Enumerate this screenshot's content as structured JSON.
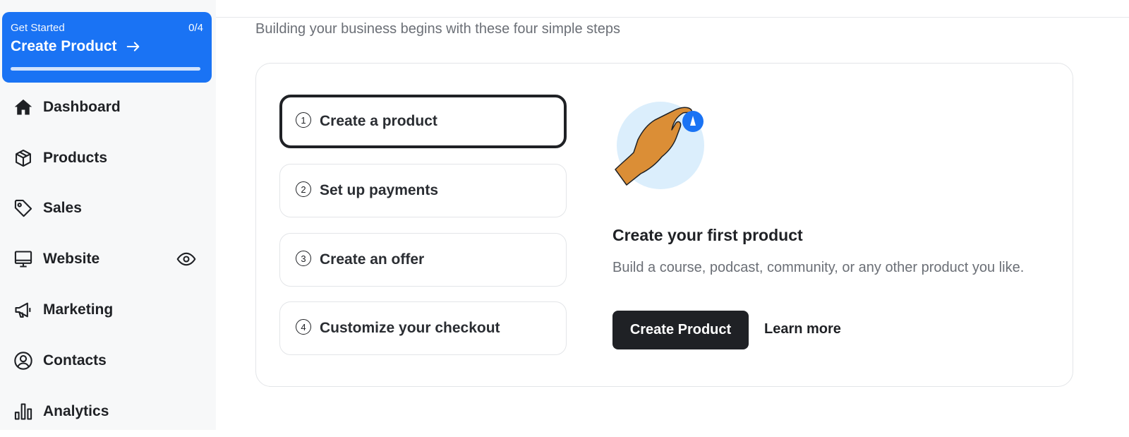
{
  "get_started": {
    "label": "Get Started",
    "count": "0/4",
    "title": "Create Product",
    "progress": 0
  },
  "sidebar": {
    "items": [
      {
        "label": "Dashboard",
        "icon": "home-icon"
      },
      {
        "label": "Products",
        "icon": "box-icon"
      },
      {
        "label": "Sales",
        "icon": "tag-icon"
      },
      {
        "label": "Website",
        "icon": "monitor-icon",
        "extra_icon": "eye-icon"
      },
      {
        "label": "Marketing",
        "icon": "megaphone-icon"
      },
      {
        "label": "Contacts",
        "icon": "user-circle-icon"
      },
      {
        "label": "Analytics",
        "icon": "bar-chart-icon"
      }
    ]
  },
  "main": {
    "subtitle": "Building your business begins with these four simple steps",
    "steps": [
      {
        "number": "1",
        "label": "Create a product",
        "active": true
      },
      {
        "number": "2",
        "label": "Set up payments",
        "active": false
      },
      {
        "number": "3",
        "label": "Create an offer",
        "active": false
      },
      {
        "number": "4",
        "label": "Customize your checkout",
        "active": false
      }
    ],
    "detail": {
      "title": "Create your first product",
      "description": "Build a course, podcast, community, or any other product you like.",
      "primary_button": "Create Product",
      "secondary_link": "Learn more"
    }
  },
  "colors": {
    "accent": "#1a73f4",
    "dark": "#1f2125",
    "muted": "#6b6f76",
    "sidebar_bg": "#f7f8f9"
  }
}
